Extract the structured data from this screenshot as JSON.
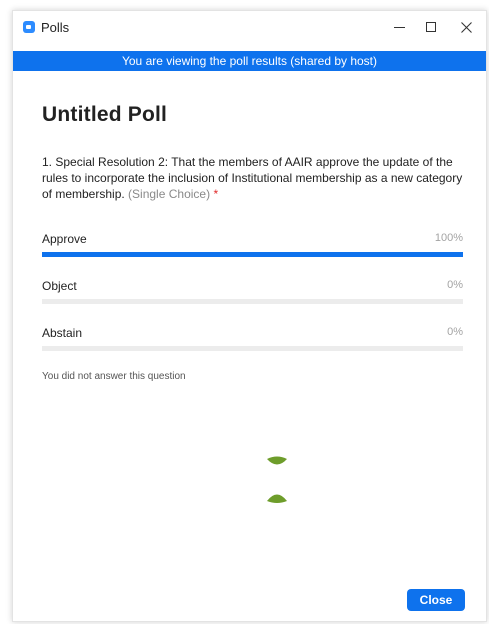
{
  "window": {
    "title": "Polls"
  },
  "banner": {
    "text": "You are viewing the poll results (shared by host)"
  },
  "poll": {
    "title": "Untitled Poll",
    "question": {
      "text": "1. Special Resolution 2: That the members of AAIR approve the update of the rules to incorporate the inclusion of Institutional membership as a new category of membership.",
      "hint": "(Single Choice)",
      "required_mark": "*"
    },
    "options": [
      {
        "label": "Approve",
        "percent_label": "100%",
        "fraction": 1.0
      },
      {
        "label": "Object",
        "percent_label": "0%",
        "fraction": 0.0
      },
      {
        "label": "Abstain",
        "percent_label": "0%",
        "fraction": 0.0
      }
    ],
    "note": "You did not answer this question"
  },
  "footer": {
    "close_label": "Close"
  },
  "colors": {
    "accent": "#0e72ed",
    "spinner": "#6e9d2b"
  },
  "icons": {
    "app": "zoom-camera-icon",
    "minimize": "minimize-icon",
    "maximize": "maximize-icon",
    "close": "close-icon",
    "loading": "loading-spinner-icon"
  }
}
